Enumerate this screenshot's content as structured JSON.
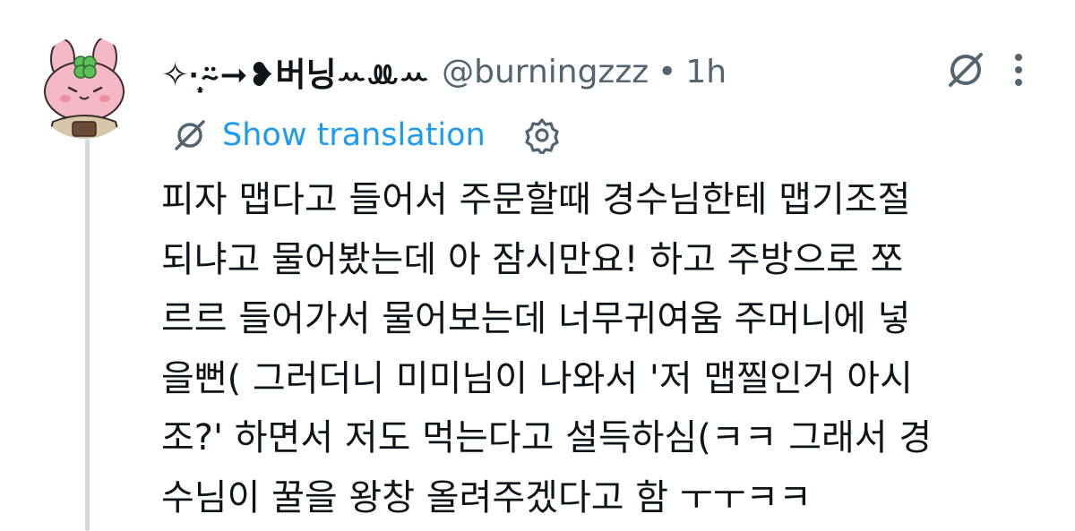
{
  "tweet": {
    "display_name": "✧·̩͙⍨➞❥버닝ꕀꔛꕀ",
    "handle": "@burningzzz",
    "separator": "•",
    "time": "1h",
    "avatar_icon": "pink-bunny-clover-avatar",
    "grok_icon": "grok-slash-circle-icon",
    "more_icon": "more-vertical-icon",
    "translation": {
      "label": "Show translation",
      "translate_icon": "translate-slash-icon",
      "settings_icon": "gear-icon"
    },
    "text_lines": [
      "피자 맵다고 들어서 주문할때 경수님한테 맵기조절",
      "되냐고 물어봤는데 아 잠시만요! 하고 주방으로 쪼",
      "르르 들어가서 물어보는데 너무귀여움 주머니에 넣",
      "을뻔( 그러더니 미미님이 나와서 '저 맵찔인거 아시",
      "조?' 하면서 저도 먹는다고 설득하심(ㅋㅋ 그래서 경",
      "수님이 꿀을 왕창 올려주겠다고 함 ㅜㅜㅋㅋ"
    ]
  },
  "colors": {
    "text": "#0f1419",
    "secondary": "#536471",
    "link": "#1d9bf0",
    "thread_line": "#cfd9de",
    "avatar_pink": "#f5b8c6",
    "clover_green": "#5cbf5a"
  }
}
